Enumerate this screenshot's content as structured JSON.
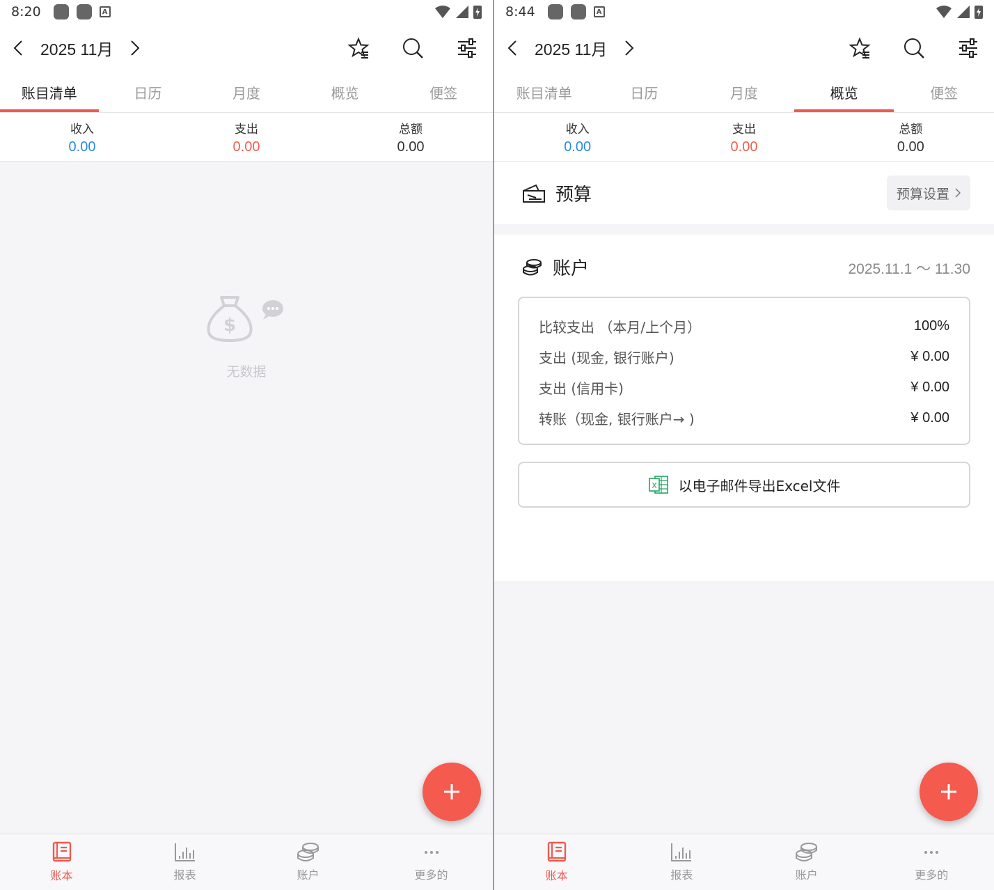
{
  "left": {
    "status": {
      "time": "8:20"
    },
    "header": {
      "month": "2025 11月"
    },
    "tabs": [
      "账目清单",
      "日历",
      "月度",
      "概览",
      "便签"
    ],
    "summary": {
      "income_label": "收入",
      "income_value": "0.00",
      "expense_label": "支出",
      "expense_value": "0.00",
      "total_label": "总额",
      "total_value": "0.00"
    },
    "empty_text": "无数据",
    "bottom_nav": [
      "账本",
      "报表",
      "账户",
      "更多的"
    ]
  },
  "right": {
    "status": {
      "time": "8:44"
    },
    "header": {
      "month": "2025 11月"
    },
    "tabs": [
      "账目清单",
      "日历",
      "月度",
      "概览",
      "便签"
    ],
    "summary": {
      "income_label": "收入",
      "income_value": "0.00",
      "expense_label": "支出",
      "expense_value": "0.00",
      "total_label": "总额",
      "total_value": "0.00"
    },
    "budget": {
      "title": "预算",
      "settings_label": "预算设置"
    },
    "account": {
      "title": "账户",
      "range": "2025.11.1 ～ 11.30",
      "rows": [
        {
          "label": "比较支出 （本月/上个月）",
          "value": "100%"
        },
        {
          "label": "支出 (现金, 银行账户)",
          "value": "¥ 0.00"
        },
        {
          "label": "支出 (信用卡)",
          "value": "¥ 0.00"
        },
        {
          "label": "转账（现金, 银行账户→ )",
          "value": "¥ 0.00"
        }
      ],
      "export_label": "以电子邮件导出Excel文件"
    },
    "bottom_nav": [
      "账本",
      "报表",
      "账户",
      "更多的"
    ]
  },
  "colors": {
    "accent": "#f05a50",
    "income": "#2b8be0",
    "expense": "#f0604f"
  },
  "icons": {
    "header": [
      "chevron-left-icon",
      "chevron-right-icon",
      "star-list-icon",
      "search-icon",
      "sliders-icon"
    ],
    "bottom_nav": [
      "book-icon",
      "bar-chart-icon",
      "coins-icon",
      "more-icon"
    ]
  }
}
